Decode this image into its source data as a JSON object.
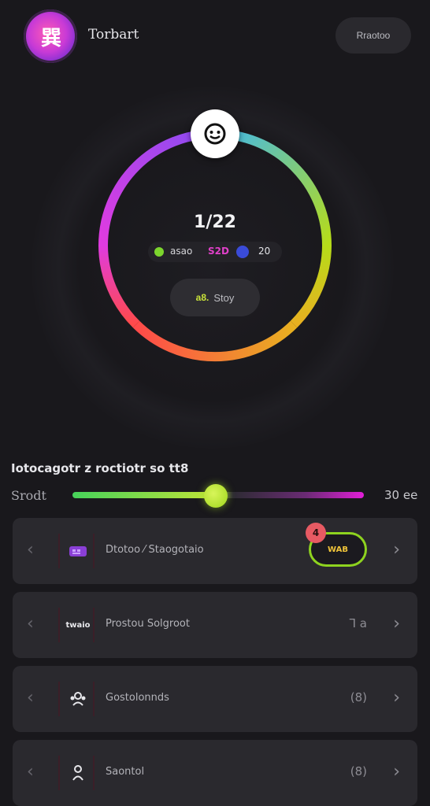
{
  "header": {
    "logo_glyph": "巽",
    "brand": "Torbart",
    "top_button": "Rraotoo"
  },
  "dial": {
    "count": "1/22",
    "stat_a_label": "asao",
    "stat_a_value": "S2D",
    "stat_b_value": "20",
    "button_icon": "a8.",
    "button_label": "Stoy",
    "gradient": [
      "#42b9ea",
      "#b6dc19",
      "#f0a02b",
      "#ff3b5a",
      "#e03be0",
      "#9c4cf0"
    ]
  },
  "slider": {
    "section_title": "Iotocagotr z roctiotr so tt8",
    "label": "Srodt",
    "value": "30 ee",
    "level_fraction": 0.5
  },
  "cards": [
    {
      "icon": "grid-icon",
      "label": "Dtotoo ⁄ Staogotaio",
      "toggle_label": "WAB",
      "badge": "4"
    },
    {
      "icon_text": "twaio",
      "label": "Prostou Solgroot",
      "meta": "⅂ a"
    },
    {
      "icon": "people-icon",
      "label": "Gostolonnds",
      "meta": "(8)"
    },
    {
      "icon": "person-icon",
      "label": "Saontol",
      "meta": "(8)"
    }
  ]
}
